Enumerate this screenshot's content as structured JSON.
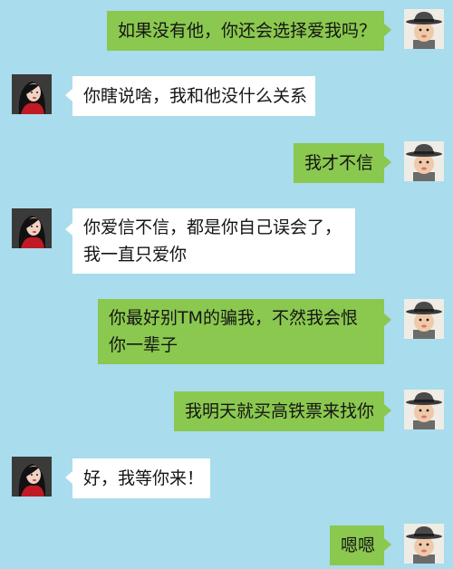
{
  "colors": {
    "background": "#a9dcec",
    "my_bubble": "#8ac84f",
    "her_bubble": "#ffffff"
  },
  "avatars": {
    "me": "boy-with-fedora-hat",
    "her": "girl-with-long-dark-hair"
  },
  "messages": [
    {
      "sender": "me",
      "lines": [
        "如果没有他，你还会选择爱我吗？"
      ]
    },
    {
      "sender": "her",
      "lines": [
        "你瞎说啥，我和他没什么关系"
      ]
    },
    {
      "sender": "me",
      "lines": [
        "我才不信"
      ]
    },
    {
      "sender": "her",
      "lines": [
        "你爱信不信，都是你自己误会了，",
        "我一直只爱你"
      ]
    },
    {
      "sender": "me",
      "lines": [
        "你最好别TM的骗我，不然我会恨",
        "你一辈子"
      ]
    },
    {
      "sender": "me",
      "lines": [
        "我明天就买高铁票来找你"
      ]
    },
    {
      "sender": "her",
      "lines": [
        "好，我等你来！"
      ]
    },
    {
      "sender": "me",
      "lines": [
        "嗯嗯"
      ]
    }
  ]
}
